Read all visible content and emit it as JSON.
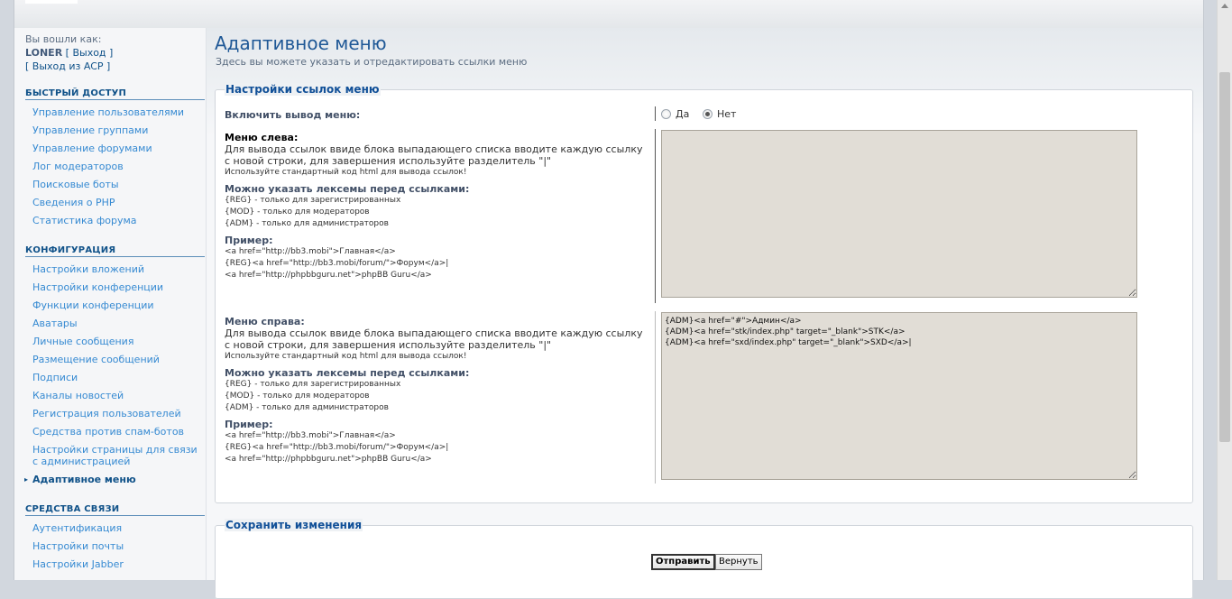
{
  "login": {
    "label": "Вы вошли как:",
    "username": "LONER",
    "logout": "[ Выход ]",
    "logout_acp": "[ Выход из ACP ]"
  },
  "sidebar": {
    "quick": {
      "title": "БЫСТРЫЙ ДОСТУП",
      "items": [
        "Управление пользователями",
        "Управление группами",
        "Управление форумами",
        "Лог модераторов",
        "Поисковые боты",
        "Сведения о PHP",
        "Статистика форума"
      ]
    },
    "config": {
      "title": "КОНФИГУРАЦИЯ",
      "items": [
        "Настройки вложений",
        "Настройки конференции",
        "Функции конференции",
        "Аватары",
        "Личные сообщения",
        "Размещение сообщений",
        "Подписи",
        "Каналы новостей",
        "Регистрация пользователей",
        "Средства против спам-ботов",
        "Настройки страницы для связи с администрацией",
        "Адаптивное меню"
      ]
    },
    "comm": {
      "title": "СРЕДСТВА СВЯЗИ",
      "items": [
        "Аутентификация",
        "Настройки почты",
        "Настройки Jabber"
      ]
    }
  },
  "main": {
    "title": "Адаптивное меню",
    "description": "Здесь вы можете указать и отредактировать ссылки меню",
    "settings": {
      "legend": "Настройки ссылок меню",
      "enable_label": "Включить вывод меню:",
      "yes": "Да",
      "no": "Нет",
      "left": {
        "title": "Меню слева:",
        "desc": "Для вывода ссылок ввиде блока выпадающего списка вводите каждую ссылку с новой строки, для завершения используйте разделитель \"|\"",
        "note": "Используйте стандартный код html для вывода ссылок!",
        "lex_title": "Можно указать лексемы перед ссылками:",
        "lex": [
          "{REG} - только для зарегистрированных",
          "{MOD} - только для модераторов",
          "{ADM} - только для администраторов"
        ],
        "example_title": "Пример:",
        "example": [
          "<a href=\"http://bb3.mobi\">Главная</a>",
          "{REG}<a href=\"http://bb3.mobi/forum/\">Форум</a>|",
          "<a href=\"http://phpbbguru.net\">phpBB Guru</a>"
        ],
        "value": ""
      },
      "right": {
        "title": "Меню справа:",
        "desc": "Для вывода ссылок ввиде блока выпадающего списка вводите каждую ссылку с новой строки, для завершения используйте разделитель \"|\"",
        "note": "Используйте стандартный код html для вывода ссылок!",
        "lex_title": "Можно указать лексемы перед ссылками:",
        "lex": [
          "{REG} - только для зарегистрированных",
          "{MOD} - только для модераторов",
          "{ADM} - только для администраторов"
        ],
        "example_title": "Пример:",
        "example": [
          "<a href=\"http://bb3.mobi\">Главная</a>",
          "{REG}<a href=\"http://bb3.mobi/forum/\">Форум</a>|",
          "<a href=\"http://phpbbguru.net\">phpBB Guru</a>"
        ],
        "value": "{ADM}<a href=\"#\">Админ</a>\n{ADM}<a href=\"stk/index.php\" target=\"_blank\">STK</a>\n{ADM}<a href=\"sxd/index.php\" target=\"_blank\">SXD</a>|"
      }
    },
    "save": {
      "legend": "Сохранить изменения",
      "submit": "Отправить",
      "reset": "Вернуть"
    }
  }
}
